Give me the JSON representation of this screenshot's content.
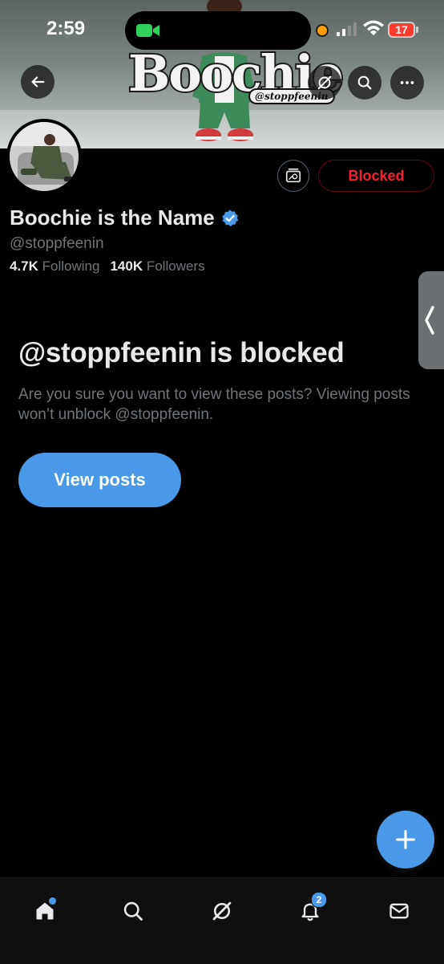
{
  "status_bar": {
    "time": "2:59",
    "battery": "17"
  },
  "banner": {
    "logo_text": "Boochie",
    "logo_handle": "@stoppfeenin"
  },
  "profile": {
    "display_name": "Boochie is the Name",
    "handle": "@stoppfeenin",
    "following_count": "4.7K",
    "following_label": "Following",
    "followers_count": "140K",
    "followers_label": "Followers",
    "blocked_button_label": "Blocked"
  },
  "blocked_notice": {
    "title": "@stoppfeenin is blocked",
    "description": "Are you sure you want to view these posts? Viewing posts won’t unblock @stoppfeenin.",
    "button_label": "View posts"
  },
  "tab_bar": {
    "notifications_badge": "2"
  },
  "colors": {
    "accent": "#4a99e9",
    "blocked_red": "#f4212e",
    "secondary_text": "#71767b",
    "primary_text": "#e7e9ea"
  },
  "icons": {
    "back": "arrow-left-icon",
    "grok": "grok-icon",
    "search": "search-icon",
    "more": "more-horizontal-icon",
    "media": "media-icon",
    "verified": "verified-badge-icon",
    "compose": "plus-icon",
    "home": "home-icon",
    "explore": "search-icon",
    "grok_tab": "grok-icon",
    "notifications": "bell-icon",
    "messages": "envelope-icon"
  }
}
